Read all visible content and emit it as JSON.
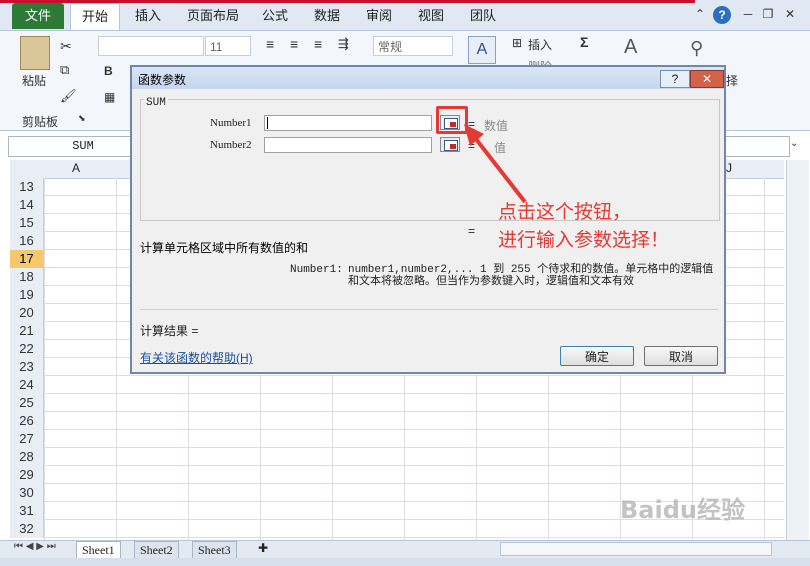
{
  "ribbon": {
    "tabs": [
      "文件",
      "开始",
      "插入",
      "页面布局",
      "公式",
      "数据",
      "审阅",
      "视图",
      "团队"
    ],
    "paste_label": "粘贴",
    "clipboard_label": "剪贴板",
    "font_size": "11",
    "number_format": "常规",
    "insert_label": "插入",
    "delete_label": "删除",
    "sort_label": "择"
  },
  "formula_bar": {
    "name_box": "SUM"
  },
  "grid": {
    "columns": [
      "A",
      "J"
    ],
    "rows": [
      "13",
      "14",
      "15",
      "16",
      "17",
      "18",
      "19",
      "20",
      "21",
      "22",
      "23",
      "24",
      "25",
      "26",
      "27",
      "28",
      "29",
      "30",
      "31",
      "32"
    ],
    "selected_row": "17"
  },
  "sheets": [
    "Sheet1",
    "Sheet2",
    "Sheet3"
  ],
  "dialog": {
    "title": "函数参数",
    "help_btn": "?",
    "close_btn": "✕",
    "function_name": "SUM",
    "args": [
      {
        "label": "Number1",
        "value_hint": "数值"
      },
      {
        "label": "Number2",
        "value_hint": "值"
      }
    ],
    "equals": "=",
    "description": "计算单元格区域中所有数值的和",
    "arg_desc_name": "Number1:",
    "arg_desc_text": "number1,number2,... 1 到 255 个待求和的数值。单元格中的逻辑值和文本将被忽略。但当作为参数键入时，逻辑值和文本有效",
    "result_label": "计算结果 =",
    "help_link": "有关该函数的帮助(H)",
    "ok_label": "确定",
    "cancel_label": "取消"
  },
  "annotation": {
    "line1": "点击这个按钮，",
    "line2": "进行输入参数选择！",
    "color": "#e53935"
  },
  "watermark": "Baidu经验"
}
